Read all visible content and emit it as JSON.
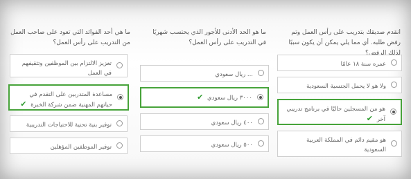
{
  "questions": [
    {
      "text": "انقدم صديقك بتدريب على رأس العمل وتم رفض طلبه. أي مما يلي يمكن أن يكون سببًا لذلك الرفض؟",
      "options": [
        {
          "label": "عمره سنة ١٨ عامًا",
          "selected": false,
          "correct": false
        },
        {
          "label": "ولا هو لا يحمل الجنسية السعودية",
          "selected": false,
          "correct": false
        },
        {
          "label": "هو من المسجلين حاليًا في برنامج تدريبي آخر",
          "selected": true,
          "correct": true
        },
        {
          "label": "هو مقيم دائم في المملكة العربية السعودية",
          "selected": false,
          "correct": false
        }
      ]
    },
    {
      "text": "ما هو الحد الأدنى للأجور الذي يحتسب شهريًا في التدريب على رأس العمل؟",
      "options": [
        {
          "label": "... ريال سعودي",
          "selected": false,
          "correct": false
        },
        {
          "label": "٣٠٠٠ ريال سعودي",
          "selected": true,
          "correct": true
        },
        {
          "label": "٤٠٠ ريال سعودي",
          "selected": false,
          "correct": false
        },
        {
          "label": "٥٠٠ ريال سعودي",
          "selected": false,
          "correct": false
        }
      ]
    },
    {
      "text": "ما هي أحد الفوائد التي تعود على صاحب العمل من التدريب على رأس العمل؟",
      "options": [
        {
          "label": "تعزيز الالتزام بين الموظفين وتثقيفهم في العمل",
          "selected": false,
          "correct": false
        },
        {
          "label": "مساعدة المتدربين على التقدم في حياتهم المهنية ضمن شركة الخبرة",
          "selected": true,
          "correct": true
        },
        {
          "label": "توفير بنية تحتية للاحتياجات التدريبية",
          "selected": false,
          "correct": false
        },
        {
          "label": "توفير الموظفين المؤهلين",
          "selected": false,
          "correct": false
        }
      ]
    }
  ],
  "icons": {
    "check": "check-icon"
  },
  "colors": {
    "selected_border": "#47a33a",
    "check": "#2f9b2f"
  }
}
